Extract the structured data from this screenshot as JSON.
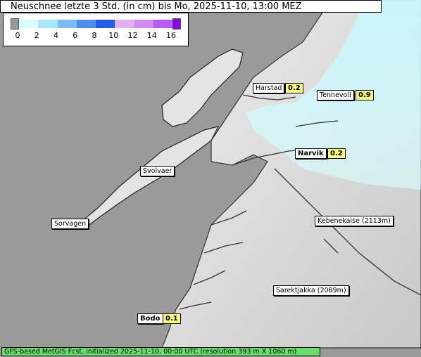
{
  "title": "Neuschnee letzte 3 Std. (in cm) bis Mo, 2025-11-10, 13:00 MEZ",
  "legend": {
    "ticks": [
      "0",
      "2",
      "4",
      "6",
      "8",
      "10",
      "12",
      "14",
      "16"
    ],
    "colors": [
      "#d8ffff",
      "#a9e4f7",
      "#7bbcf0",
      "#4a90ea",
      "#1f5ee6",
      "#e0b0f0",
      "#cf8cf0",
      "#b45ef0",
      "#8a00e8"
    ]
  },
  "places": [
    {
      "name": "Harstad",
      "value": "0.2"
    },
    {
      "name": "Tennevoll",
      "value": "0.9"
    },
    {
      "name": "Narvik",
      "value": "0.2"
    },
    {
      "name": "Svolvaer",
      "value": ""
    },
    {
      "name": "Sorvagen",
      "value": ""
    },
    {
      "name": "Kebenekaise (2113m)",
      "value": ""
    },
    {
      "name": "Sarektjakka (2089m)",
      "value": ""
    },
    {
      "name": "Bodo",
      "value": "0.1"
    }
  ],
  "footer": "GFS-based MetGIS Fcst, initialized 2025-11-10, 00:00 UTC  (resolution 393 m X 1060 m)",
  "colors": {
    "sea": "#9a9a9a",
    "land": "#dcdcdc",
    "snow_light": "#d8ffff",
    "value_bg": "#ffff80",
    "footer_bg": "#66e066"
  }
}
